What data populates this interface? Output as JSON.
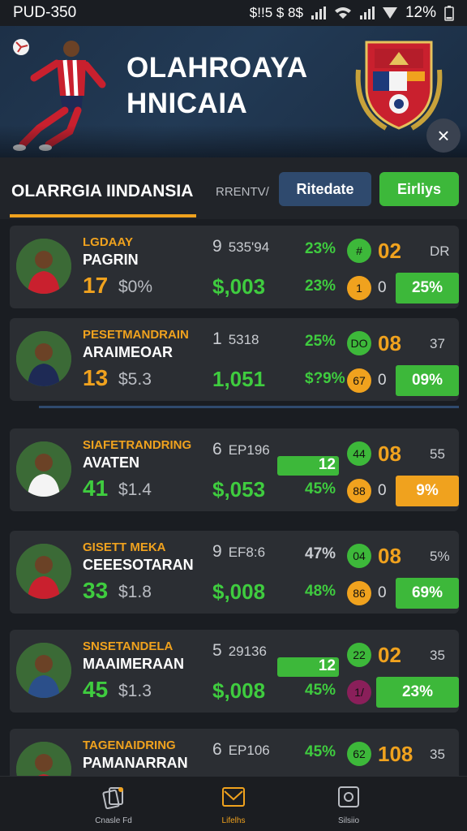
{
  "status_bar": {
    "left": "PUD-350",
    "icons": "$!!5 $ 8$",
    "battery": "12%"
  },
  "header": {
    "title_line1": "OLAHROAYA",
    "title_line2": "HNICAIA",
    "close_label": "×"
  },
  "tabs": {
    "main": "OLARRGIA IINDANSIA",
    "prev": "RRENTV/",
    "blue_pill": "Ritedate",
    "green_pill": "Eirliys"
  },
  "colors": {
    "accent": "#f0a21e",
    "green": "#3db83a",
    "blue": "#2f4a6e"
  },
  "rows": [
    {
      "label": "LGDAAY",
      "name": "PAGRIN",
      "num": "17",
      "num_color": "#f0a21e",
      "price": "$0%",
      "code_a": "9",
      "code_b": "535'94",
      "money": "$,003",
      "pct1": "23%",
      "pct2": "23%",
      "c1": "#3db83a",
      "c1_text": "#",
      "c2": "#f0a21e",
      "c2_text": "1",
      "big": "02",
      "zero": "0",
      "right": "DR",
      "btn": "25%",
      "btn_color": "#3db83a"
    },
    {
      "label": "PESETMANDRAIN",
      "name": "ARAIMEOAR",
      "num": "13",
      "num_color": "#f0a21e",
      "price": "$5.3",
      "code_a": "1",
      "code_b": "5318",
      "money": "1,051",
      "pct1": "25%",
      "pct2": "$?9%",
      "c1": "#3db83a",
      "c1_text": "DO",
      "c2": "#f0a21e",
      "c2_text": "67",
      "big": "08",
      "zero": "0",
      "right": "37",
      "btn": "09%",
      "btn_color": "#3db83a"
    },
    {
      "label": "SIAFETRANDRING",
      "name": "AVATEN",
      "num": "41",
      "num_color": "#3fcc3f",
      "price": "$1.4",
      "code_a": "6",
      "code_b": "EP196",
      "money": "$,053",
      "pct1": "12",
      "pct2": "45%",
      "c1": "#3db83a",
      "c1_text": "44",
      "c2": "#f0a21e",
      "c2_text": "88",
      "big": "08",
      "zero": "0",
      "right": "55",
      "btn": "9%",
      "btn_color": "#f0a21e"
    },
    {
      "label": "GISETT MEKA",
      "name": "CEEESOTARAN",
      "num": "33",
      "num_color": "#3fcc3f",
      "price": "$1.8",
      "code_a": "9",
      "code_b": "EF8:6",
      "money": "$,008",
      "pct1": "47%",
      "pct2": "48%",
      "c1": "#3db83a",
      "c1_text": "04",
      "c2": "#f0a21e",
      "c2_text": "86",
      "big": "08",
      "zero": "0",
      "right": "5%",
      "btn": "69%",
      "btn_color": "#3db83a"
    },
    {
      "label": "SNSETANDELA",
      "name": "MAAIMERAAN",
      "num": "45",
      "num_color": "#3fcc3f",
      "price": "$1.3",
      "code_a": "5",
      "code_b": "29136",
      "money": "$,008",
      "pct1": "12",
      "pct2": "45%",
      "c1": "#3db83a",
      "c1_text": "22",
      "c2": "#8a1f5a",
      "c2_text": "1/",
      "big": "02",
      "zero": "",
      "right": "35",
      "btn": "23%",
      "btn_color": "#3db83a"
    },
    {
      "label": "TAGENAIDRING",
      "name": "PAMANARRAN",
      "num": "",
      "num_color": "#3fcc3f",
      "price": "",
      "code_a": "6",
      "code_b": "EP106",
      "money": "",
      "pct1": "45%",
      "pct2": "",
      "c1": "#3db83a",
      "c1_text": "62",
      "c2": "",
      "c2_text": "",
      "big": "108",
      "zero": "",
      "right": "35",
      "btn": "",
      "btn_color": ""
    }
  ],
  "bottom_nav": [
    {
      "label": "Cnasle Fd",
      "icon": "cards-icon"
    },
    {
      "label": "Lifelhs",
      "icon": "envelope-icon"
    },
    {
      "label": "Silsiio",
      "icon": "square-icon"
    }
  ]
}
